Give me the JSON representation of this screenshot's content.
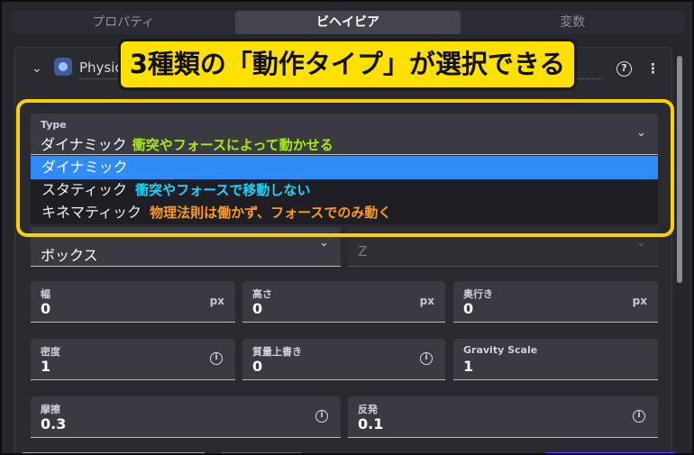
{
  "tabs": [
    {
      "label": "プロパティ"
    },
    {
      "label": "ビヘイビア"
    },
    {
      "label": "変数"
    }
  ],
  "header": {
    "name": "Physics"
  },
  "callout": {
    "text": "3種類の「動作タイプ」が選択できる"
  },
  "type_select": {
    "label": "Type",
    "value": "ダイナミック",
    "note": "衝突やフォースによって動かせる",
    "options": [
      {
        "label": "ダイナミック",
        "note": ""
      },
      {
        "label": "スタティック",
        "note": "衝突やフォースで移動しない",
        "note_color": "#15d6ff"
      },
      {
        "label": "キネマティック",
        "note": "物理法則は働かず、フォースでのみ動く",
        "note_color": "#ff9a1a"
      }
    ]
  },
  "shape_select": {
    "value": "ボックス"
  },
  "orientation_select": {
    "value": "Z"
  },
  "fields": {
    "width": {
      "label": "幅",
      "value": "0",
      "unit": "px"
    },
    "height": {
      "label": "高さ",
      "value": "0",
      "unit": "px"
    },
    "depth": {
      "label": "奥行き",
      "value": "0",
      "unit": "px"
    },
    "density": {
      "label": "密度",
      "value": "1"
    },
    "mass": {
      "label": "質量上書き",
      "value": "0"
    },
    "gravity_scale": {
      "label": "Gravity Scale",
      "value": "1"
    },
    "friction": {
      "label": "摩擦",
      "value": "0.3"
    },
    "restitution": {
      "label": "反発",
      "value": "0.1"
    }
  },
  "colors": {
    "accent": "#2f8cf6",
    "highlight": "#ffd000",
    "note_green": "#a6ee00"
  }
}
